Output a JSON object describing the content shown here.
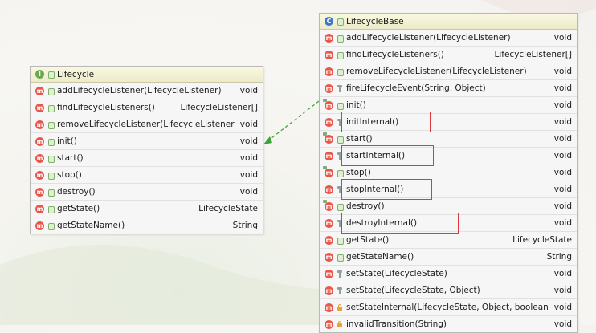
{
  "lifecycle": {
    "title": "Lifecycle",
    "icon": "interface-icon",
    "methods": [
      {
        "name": "addLifecycleListener(LifecycleListener)",
        "ret": "void",
        "vis": "public"
      },
      {
        "name": "findLifecycleListeners()",
        "ret": "LifecycleListener[]",
        "vis": "public"
      },
      {
        "name": "removeLifecycleListener(LifecycleListener)",
        "ret": "void",
        "vis": "public"
      },
      {
        "name": "init()",
        "ret": "void",
        "vis": "public"
      },
      {
        "name": "start()",
        "ret": "void",
        "vis": "public"
      },
      {
        "name": "stop()",
        "ret": "void",
        "vis": "public"
      },
      {
        "name": "destroy()",
        "ret": "void",
        "vis": "public"
      },
      {
        "name": "getState()",
        "ret": "LifecycleState",
        "vis": "public"
      },
      {
        "name": "getStateName()",
        "ret": "String",
        "vis": "public"
      }
    ]
  },
  "lifecycleBase": {
    "title": "LifecycleBase",
    "icon": "class-icon",
    "methods": [
      {
        "name": "addLifecycleListener(LifecycleListener)",
        "ret": "void",
        "vis": "public",
        "pin": false,
        "hl": false
      },
      {
        "name": "findLifecycleListeners()",
        "ret": "LifecycleListener[]",
        "vis": "public",
        "pin": false,
        "hl": false
      },
      {
        "name": "removeLifecycleListener(LifecycleListener)",
        "ret": "void",
        "vis": "public",
        "pin": false,
        "hl": false
      },
      {
        "name": "fireLifecycleEvent(String, Object)",
        "ret": "void",
        "vis": "protected",
        "pin": false,
        "hl": false
      },
      {
        "name": "init()",
        "ret": "void",
        "vis": "public",
        "pin": true,
        "hl": false
      },
      {
        "name": "initInternal()",
        "ret": "void",
        "vis": "protected",
        "pin": false,
        "hl": true
      },
      {
        "name": "start()",
        "ret": "void",
        "vis": "public",
        "pin": true,
        "hl": false
      },
      {
        "name": "startInternal()",
        "ret": "void",
        "vis": "protected",
        "pin": false,
        "hl": true
      },
      {
        "name": "stop()",
        "ret": "void",
        "vis": "public",
        "pin": true,
        "hl": false
      },
      {
        "name": "stopInternal()",
        "ret": "void",
        "vis": "protected",
        "pin": false,
        "hl": true
      },
      {
        "name": "destroy()",
        "ret": "void",
        "vis": "public",
        "pin": true,
        "hl": false
      },
      {
        "name": "destroyInternal()",
        "ret": "void",
        "vis": "protected",
        "pin": false,
        "hl": true
      },
      {
        "name": "getState()",
        "ret": "LifecycleState",
        "vis": "public",
        "pin": false,
        "hl": false
      },
      {
        "name": "getStateName()",
        "ret": "String",
        "vis": "public",
        "pin": false,
        "hl": false
      },
      {
        "name": "setState(LifecycleState)",
        "ret": "void",
        "vis": "protected",
        "pin": false,
        "hl": false
      },
      {
        "name": "setState(LifecycleState, Object)",
        "ret": "void",
        "vis": "protected",
        "pin": false,
        "hl": false
      },
      {
        "name": "setStateInternal(LifecycleState, Object, boolean)",
        "ret": "void",
        "vis": "private",
        "pin": false,
        "hl": false
      },
      {
        "name": "invalidTransition(String)",
        "ret": "void",
        "vis": "private",
        "pin": false,
        "hl": false
      }
    ]
  },
  "relation": {
    "type": "implements",
    "from": "LifecycleBase",
    "to": "Lifecycle",
    "color": "#3aa23a"
  },
  "colors": {
    "method_icon": "#e9574b",
    "interface_icon": "#6aa84f",
    "class_icon": "#3c78c6",
    "highlight": "#e0393b"
  }
}
